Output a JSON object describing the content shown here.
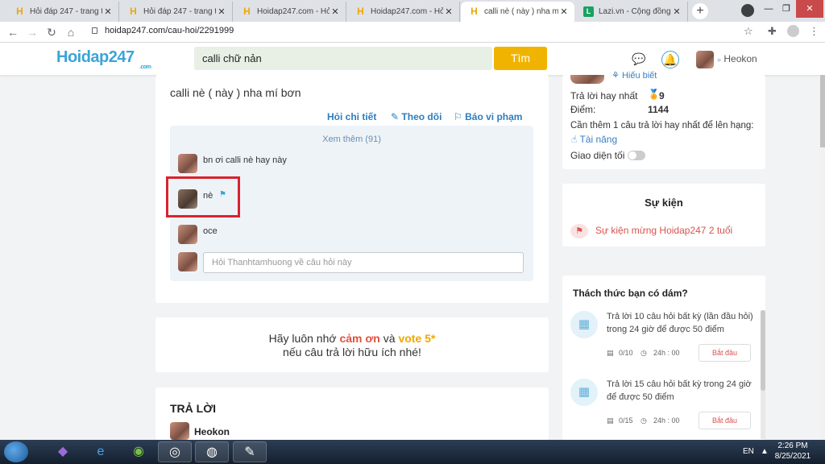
{
  "browser": {
    "tabs": [
      {
        "title": "Hỏi đáp 247 - trang tra",
        "icon": "hoidap-favicon"
      },
      {
        "title": "Hỏi đáp 247 - trang tra",
        "icon": "hoidap-favicon"
      },
      {
        "title": "Hoidap247.com - Hỏi đ",
        "icon": "hoidap-favicon"
      },
      {
        "title": "Hoidap247.com - Hỏi đ",
        "icon": "hoidap-favicon"
      },
      {
        "title": "calli nè ( này ) nha mí b",
        "icon": "hoidap-favicon"
      },
      {
        "title": "Lazi.vn - Cộng đồng tri",
        "icon": "lazi-favicon"
      }
    ],
    "active_tab": 4,
    "url": "hoidap247.com/cau-hoi/2291999"
  },
  "header": {
    "logo": "Hoidap247",
    "logo_suffix": ".com",
    "search_value": "calli chữ nản",
    "search_button": "Tìm",
    "user_name": "Heokon"
  },
  "question": {
    "text": "calli nè ( này ) nha mí bơn",
    "actions": [
      "Hỏi chi tiết",
      "Theo dõi",
      "Báo vi phạm"
    ],
    "see_more": "Xem thêm (91)",
    "comments": [
      {
        "text": "bn ơi calli nè hay này"
      },
      {
        "text": "nè"
      },
      {
        "text": "oce"
      }
    ],
    "ask_placeholder": "Hỏi Thanhtamhuong về câu hỏi này"
  },
  "reminder": {
    "line1_prefix": "Hãy luôn nhớ ",
    "thanks": "cảm ơn",
    "and": " và ",
    "vote": "vote 5*",
    "line2": "nếu câu trả lời hữu ích nhé!"
  },
  "answers": {
    "title": "TRẢ LỜI",
    "first_user": "Heokon"
  },
  "sidebar": {
    "profile_link": "Hiếu biết",
    "best_answers_label": "Trả lời hay nhất",
    "best_answers_value": "9",
    "points_label": "Điểm:",
    "points_value": "1144",
    "rank_note": "Cần thêm 1 câu trả lời hay nhất để lên hạng:",
    "skill_link": "Tài năng",
    "dark_mode_label": "Giao diện tối",
    "event_title": "Sự kiện",
    "event_item": "Sự kiện mừng Hoidap247 2 tuổi",
    "challenge_title": "Thách thức bạn có dám?",
    "challenges": [
      {
        "text": "Trả lời 10 câu hỏi  bất kỳ (lần đầu hỏi) trong 24 giờ để được 50 điểm",
        "progress": "0/10",
        "time": "24h : 00",
        "button": "Bắt đầu"
      },
      {
        "text": "Trả lời 15 câu hỏi  bất kỳ  trong 24 giờ để được 50 điểm",
        "progress": "0/15",
        "time": "24h : 00",
        "button": "Bắt đầu"
      }
    ]
  },
  "taskbar": {
    "language": "EN",
    "time": "2:26 PM",
    "date": "8/25/2021"
  },
  "colors": {
    "accent_blue": "#3ba4d8",
    "brand_yellow": "#f0b400",
    "highlight_red": "#d9232d",
    "link_blue": "#2d7dbf"
  }
}
